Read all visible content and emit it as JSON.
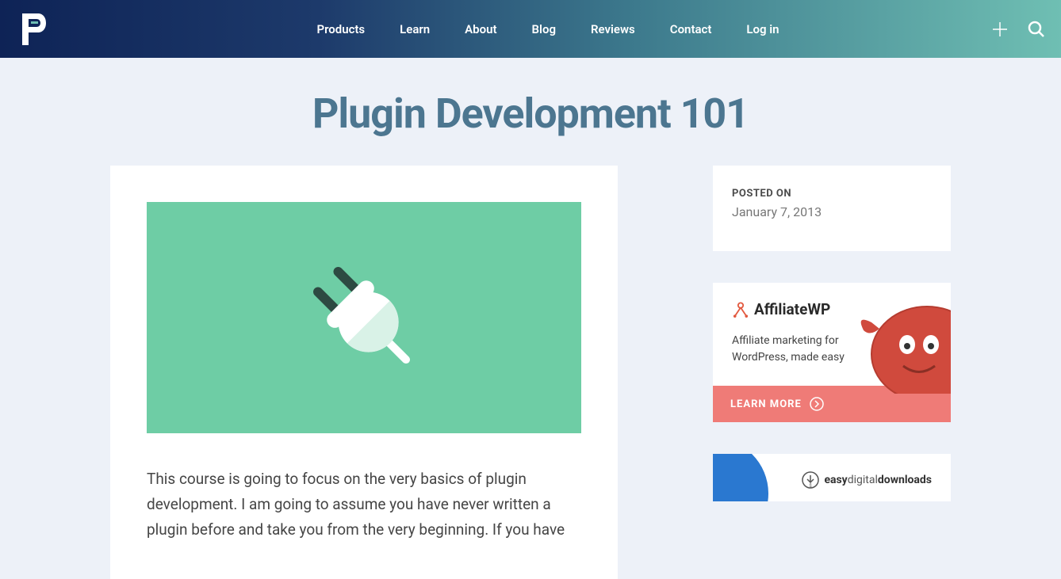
{
  "nav": {
    "items": [
      "Products",
      "Learn",
      "About",
      "Blog",
      "Reviews",
      "Contact",
      "Log in"
    ]
  },
  "page": {
    "title": "Plugin Development 101",
    "body": "This course is going to focus on the very basics of plugin development. I am going to assume you have never written a plugin before and take you from the very beginning. If you have"
  },
  "sidebar": {
    "posted": {
      "label": "POSTED ON",
      "date": "January 7, 2013"
    },
    "affiliate": {
      "brand": "AffiliateWP",
      "tagline": "Affiliate marketing for WordPress, made easy",
      "cta": "LEARN MORE"
    },
    "edd": {
      "prefix": "easy",
      "middle": "digital",
      "suffix": "downloads"
    }
  }
}
